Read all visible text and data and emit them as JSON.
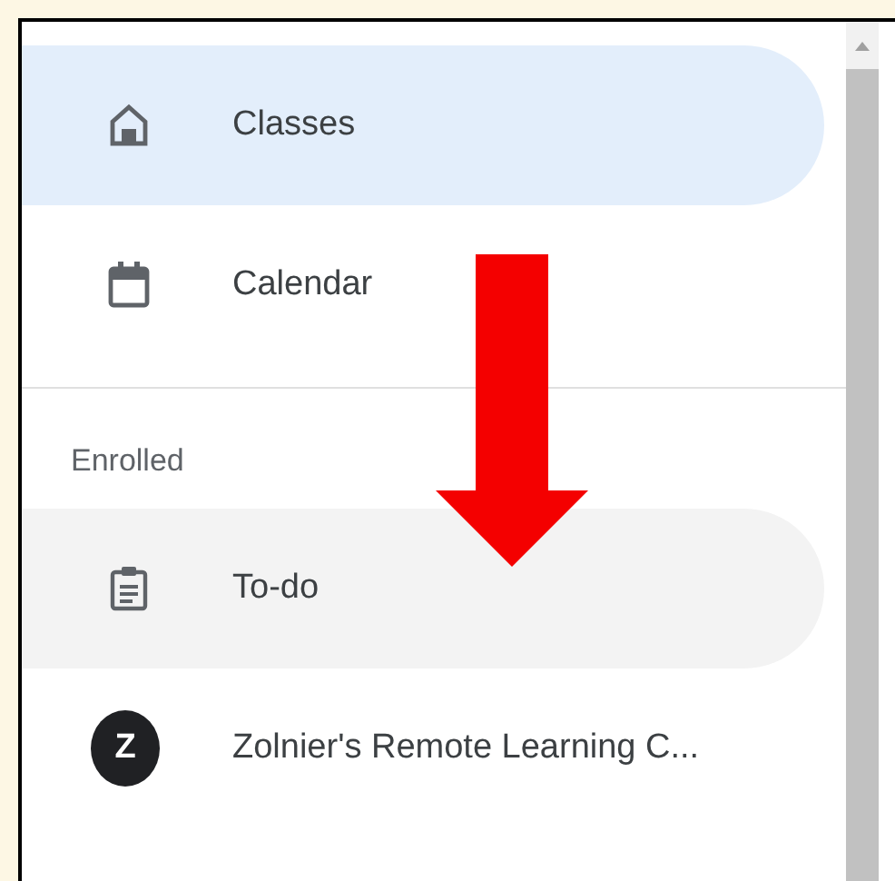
{
  "nav": [
    {
      "label": "Classes",
      "kind": "home",
      "selected": true,
      "hovered": false
    },
    {
      "label": "Calendar",
      "kind": "calendar",
      "selected": false,
      "hovered": false
    }
  ],
  "enrolled": {
    "heading": "Enrolled",
    "items": [
      {
        "label": "To-do",
        "kind": "todo",
        "selected": false,
        "hovered": true
      },
      {
        "label": "Zolnier's Remote Learning C...",
        "kind": "class",
        "avatar": "Z",
        "selected": false,
        "hovered": false
      }
    ]
  }
}
